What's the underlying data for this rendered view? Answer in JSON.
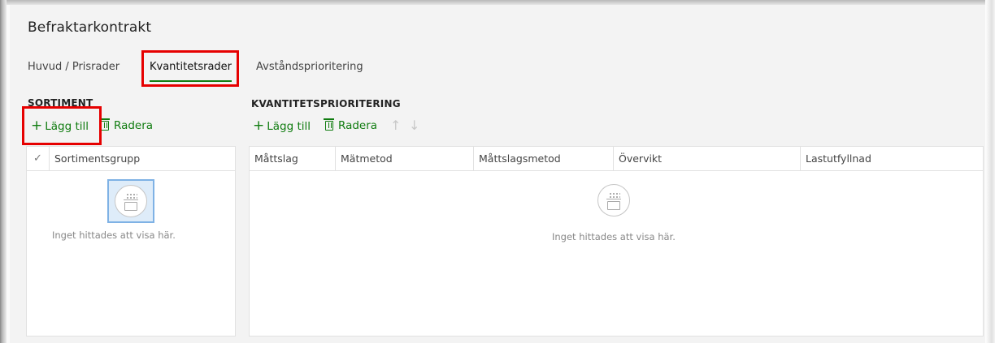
{
  "page": {
    "title": "Befraktarkontrakt"
  },
  "tabs": [
    {
      "label": "Huvud / Prisrader"
    },
    {
      "label": "Kvantitetsrader",
      "selected": true
    },
    {
      "label": "Avståndsprioritering"
    }
  ],
  "left_section": {
    "title": "SORTIMENT",
    "add_label": "Lägg till",
    "delete_label": "Radera",
    "columns": [
      "Sortimentsgrupp"
    ],
    "empty_text": "Inget hittades att visa här."
  },
  "right_section": {
    "title": "KVANTITETSPRIORITERING",
    "add_label": "Lägg till",
    "delete_label": "Radera",
    "columns": [
      "Måttslag",
      "Mätmetod",
      "Måttslagsmetod",
      "Övervikt",
      "Lastutfyllnad"
    ],
    "empty_text": "Inget hittades att visa här."
  },
  "icons": {
    "add": "plus-icon",
    "delete": "trash-icon",
    "move_up": "arrow-up-icon",
    "move_down": "arrow-down-icon",
    "select_all": "checkmark-icon",
    "empty": "empty-box-icon"
  },
  "colors": {
    "accent": "#107c10",
    "highlight": "#e60000",
    "focus": "#7fb2e5"
  }
}
